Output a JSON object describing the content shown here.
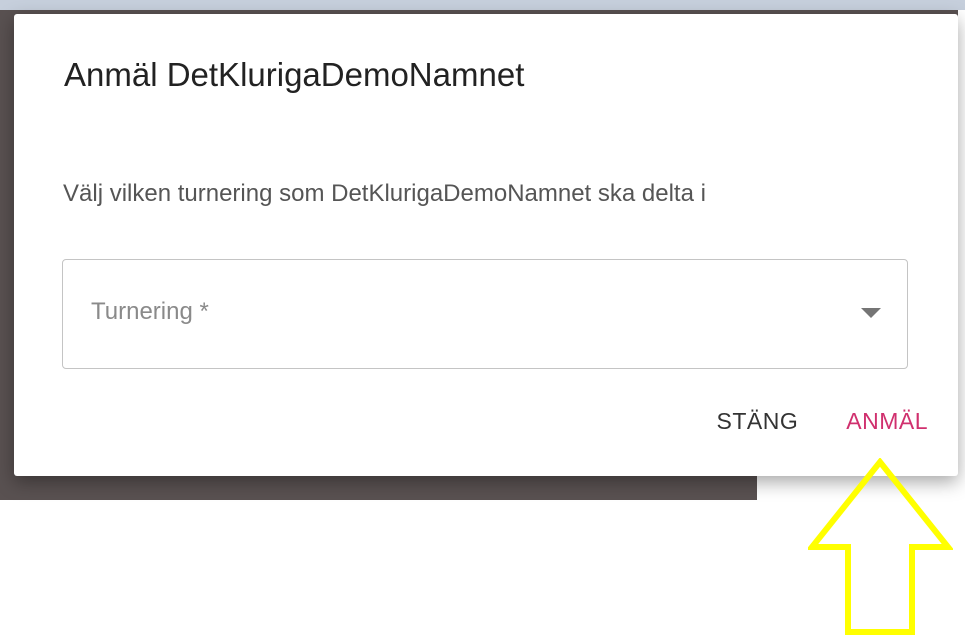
{
  "dialog": {
    "title": "Anmäl DetKlurigaDemoNamnet",
    "description": "Välj vilken turnering som DetKlurigaDemoNamnet ska delta i",
    "select": {
      "label": "Turnering *",
      "value": ""
    },
    "actions": {
      "close_label": "STÄNG",
      "register_label": "ANMÄL"
    }
  },
  "colors": {
    "accent": "#d0306e",
    "annotation_arrow": "#ffff00",
    "backdrop": "#595151"
  },
  "icons": {
    "select_arrow": "caret-down-icon",
    "annotation": "up-arrow-icon"
  }
}
